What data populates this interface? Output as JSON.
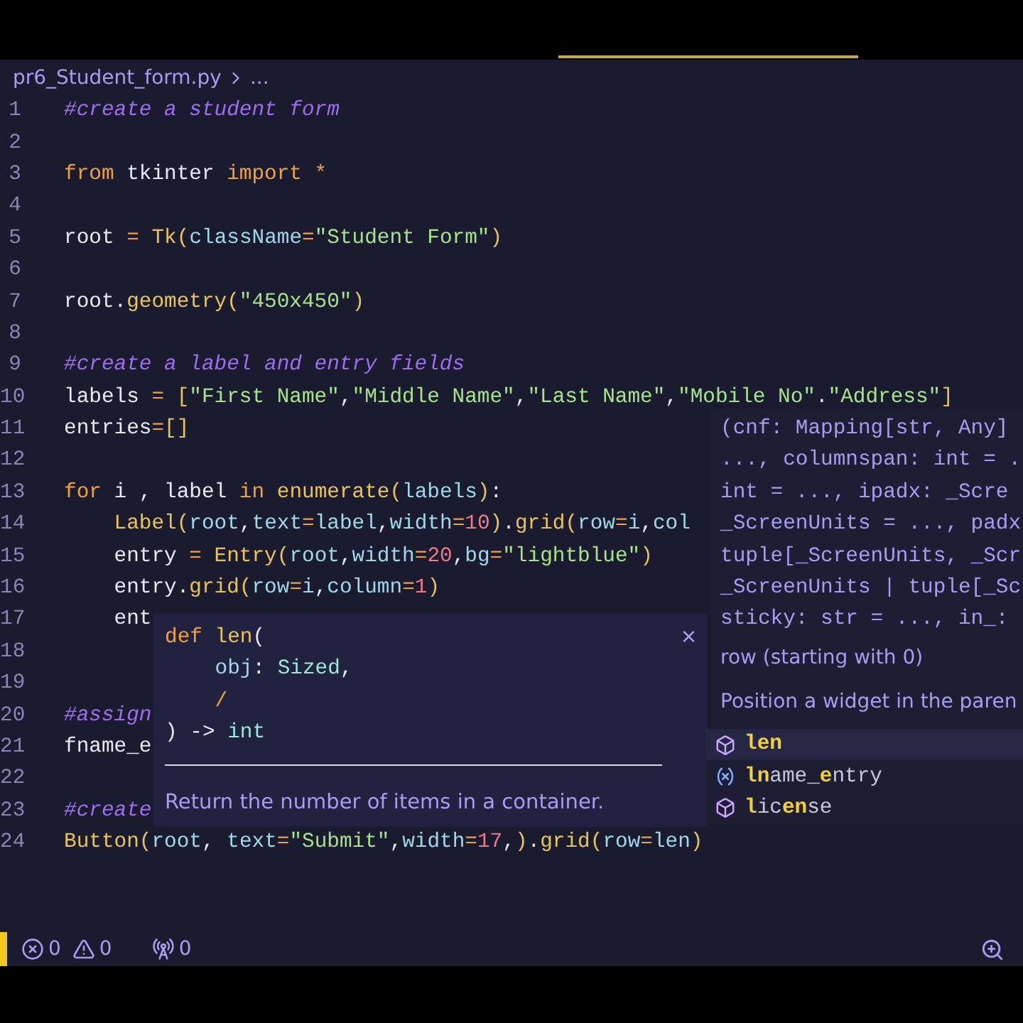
{
  "breadcrumb": {
    "file": "pr6_Student_form.py",
    "tail": "..."
  },
  "lines": [
    {
      "number": "1",
      "tokens": [
        {
          "text": "#create a student form",
          "kind": "comment"
        }
      ]
    },
    {
      "number": "2"
    },
    {
      "number": "3",
      "tokens": [
        {
          "text": "from",
          "kind": "keyword"
        },
        {
          "text": " tkinter ",
          "kind": "name"
        },
        {
          "text": "import",
          "kind": "keyword"
        },
        {
          "text": " *",
          "kind": "op"
        }
      ]
    },
    {
      "number": "4"
    },
    {
      "number": "5",
      "tokens": [
        {
          "text": "root ",
          "kind": "name"
        },
        {
          "text": "= ",
          "kind": "op"
        },
        {
          "text": "Tk",
          "kind": "func"
        },
        {
          "text": "(",
          "kind": "paren"
        },
        {
          "text": "className",
          "kind": "param"
        },
        {
          "text": "=",
          "kind": "op"
        },
        {
          "text": "\"Student Form\"",
          "kind": "string"
        },
        {
          "text": ")",
          "kind": "paren"
        }
      ]
    },
    {
      "number": "6"
    },
    {
      "number": "7",
      "tokens": [
        {
          "text": "root.",
          "kind": "name"
        },
        {
          "text": "geometry",
          "kind": "func"
        },
        {
          "text": "(",
          "kind": "paren"
        },
        {
          "text": "\"450x450\"",
          "kind": "string"
        },
        {
          "text": ")",
          "kind": "paren"
        }
      ]
    },
    {
      "number": "8"
    },
    {
      "number": "9",
      "tokens": [
        {
          "text": "#create a label and entry fields",
          "kind": "comment"
        }
      ]
    },
    {
      "number": "10",
      "tokens": [
        {
          "text": "labels ",
          "kind": "name"
        },
        {
          "text": "= ",
          "kind": "op"
        },
        {
          "text": "[",
          "kind": "paren"
        },
        {
          "text": "\"First Name\"",
          "kind": "string"
        },
        {
          "text": ",",
          "kind": "name"
        },
        {
          "text": "\"Middle Name\"",
          "kind": "string"
        },
        {
          "text": ",",
          "kind": "name"
        },
        {
          "text": "\"Last Name\"",
          "kind": "string"
        },
        {
          "text": ",",
          "kind": "name"
        },
        {
          "text": "\"Mobile No\"",
          "kind": "string"
        },
        {
          "text": ".",
          "kind": "name"
        },
        {
          "text": "\"Address\"",
          "kind": "string"
        },
        {
          "text": "]",
          "kind": "paren"
        }
      ]
    },
    {
      "number": "11",
      "tokens": [
        {
          "text": "entries",
          "kind": "name"
        },
        {
          "text": "=",
          "kind": "op"
        },
        {
          "text": "[]",
          "kind": "paren"
        }
      ]
    },
    {
      "number": "12"
    },
    {
      "number": "13",
      "tokens": [
        {
          "text": "for",
          "kind": "keyword"
        },
        {
          "text": " i , label ",
          "kind": "name"
        },
        {
          "text": "in ",
          "kind": "keyword"
        },
        {
          "text": "enumerate",
          "kind": "func"
        },
        {
          "text": "(",
          "kind": "paren"
        },
        {
          "text": "labels",
          "kind": "param"
        },
        {
          "text": ")",
          "kind": "paren"
        },
        {
          "text": ":",
          "kind": "name"
        }
      ]
    },
    {
      "number": "14",
      "tokens": [
        {
          "text": "    Label",
          "kind": "func"
        },
        {
          "text": "(",
          "kind": "paren"
        },
        {
          "text": "root",
          "kind": "param"
        },
        {
          "text": ",",
          "kind": "name"
        },
        {
          "text": "text",
          "kind": "param"
        },
        {
          "text": "=",
          "kind": "op"
        },
        {
          "text": "label",
          "kind": "param"
        },
        {
          "text": ",",
          "kind": "name"
        },
        {
          "text": "width",
          "kind": "param"
        },
        {
          "text": "=",
          "kind": "op"
        },
        {
          "text": "10",
          "kind": "number"
        },
        {
          "text": ")",
          "kind": "paren"
        },
        {
          "text": ".",
          "kind": "name"
        },
        {
          "text": "grid",
          "kind": "func"
        },
        {
          "text": "(",
          "kind": "paren"
        },
        {
          "text": "row",
          "kind": "param"
        },
        {
          "text": "=",
          "kind": "op"
        },
        {
          "text": "i",
          "kind": "param"
        },
        {
          "text": ",",
          "kind": "name"
        },
        {
          "text": "col",
          "kind": "param"
        }
      ]
    },
    {
      "number": "15",
      "tokens": [
        {
          "text": "    entry ",
          "kind": "name"
        },
        {
          "text": "= ",
          "kind": "op"
        },
        {
          "text": "Entry",
          "kind": "func"
        },
        {
          "text": "(",
          "kind": "paren"
        },
        {
          "text": "root",
          "kind": "param"
        },
        {
          "text": ",",
          "kind": "name"
        },
        {
          "text": "width",
          "kind": "param"
        },
        {
          "text": "=",
          "kind": "op"
        },
        {
          "text": "20",
          "kind": "number"
        },
        {
          "text": ",",
          "kind": "name"
        },
        {
          "text": "bg",
          "kind": "param"
        },
        {
          "text": "=",
          "kind": "op"
        },
        {
          "text": "\"lightblue\"",
          "kind": "string"
        },
        {
          "text": ")",
          "kind": "paren"
        }
      ]
    },
    {
      "number": "16",
      "tokens": [
        {
          "text": "    entry.",
          "kind": "name"
        },
        {
          "text": "grid",
          "kind": "func"
        },
        {
          "text": "(",
          "kind": "paren"
        },
        {
          "text": "row",
          "kind": "param"
        },
        {
          "text": "=",
          "kind": "op"
        },
        {
          "text": "i",
          "kind": "param"
        },
        {
          "text": ",",
          "kind": "name"
        },
        {
          "text": "column",
          "kind": "param"
        },
        {
          "text": "=",
          "kind": "op"
        },
        {
          "text": "1",
          "kind": "number"
        },
        {
          "text": ")",
          "kind": "paren"
        }
      ]
    },
    {
      "number": "17",
      "tokens": [
        {
          "text": "    ent",
          "kind": "name"
        }
      ]
    },
    {
      "number": "18"
    },
    {
      "number": "19"
    },
    {
      "number": "20",
      "tokens": [
        {
          "text": "#assign",
          "kind": "comment"
        }
      ]
    },
    {
      "number": "21",
      "tokens": [
        {
          "text": "fname_e",
          "kind": "name"
        }
      ]
    },
    {
      "number": "22"
    },
    {
      "number": "23",
      "tokens": [
        {
          "text": "#create",
          "kind": "comment"
        }
      ]
    },
    {
      "number": "24",
      "tokens": [
        {
          "text": "Button",
          "kind": "func"
        },
        {
          "text": "(",
          "kind": "paren"
        },
        {
          "text": "root",
          "kind": "param"
        },
        {
          "text": ", ",
          "kind": "name"
        },
        {
          "text": "text",
          "kind": "param"
        },
        {
          "text": "=",
          "kind": "op"
        },
        {
          "text": "\"Submit\"",
          "kind": "string"
        },
        {
          "text": ",",
          "kind": "name"
        },
        {
          "text": "width",
          "kind": "param"
        },
        {
          "text": "=",
          "kind": "op"
        },
        {
          "text": "17",
          "kind": "number"
        },
        {
          "text": ",",
          "kind": "name"
        },
        {
          "text": ")",
          "kind": "paren"
        },
        {
          "text": ".",
          "kind": "name"
        },
        {
          "text": "grid",
          "kind": "func"
        },
        {
          "text": "(",
          "kind": "paren"
        },
        {
          "text": "row",
          "kind": "param"
        },
        {
          "text": "=",
          "kind": "op"
        },
        {
          "text": "len",
          "kind": "param"
        },
        {
          "text": ")",
          "kind": "paren"
        }
      ]
    }
  ],
  "signature_help": {
    "lines": [
      "(cnf: Mapping[str, Any]",
      "..., columnspan: int = .",
      "int = ..., ipadx: _Scre",
      "_ScreenUnits = ..., padx",
      "tuple[_ScreenUnits, _Scr",
      "_ScreenUnits | tuple[_Sc",
      "sticky: str = ..., in_:"
    ],
    "param_doc": "row (starting with 0)",
    "description": "Position a widget in the paren"
  },
  "hover": {
    "close": "×",
    "code": [
      [
        {
          "text": "def ",
          "kind": "keyword"
        },
        {
          "text": "len",
          "kind": "func"
        },
        {
          "text": "(",
          "kind": "name"
        }
      ],
      [
        {
          "text": "    obj",
          "kind": "param"
        },
        {
          "text": ": ",
          "kind": "name"
        },
        {
          "text": "Sized",
          "kind": "type"
        },
        {
          "text": ",",
          "kind": "name"
        }
      ],
      [
        {
          "text": "    /",
          "kind": "op"
        }
      ],
      [
        {
          "text": ")",
          "kind": "name"
        },
        {
          "text": " -> ",
          "kind": "name"
        },
        {
          "text": "int",
          "kind": "type"
        }
      ]
    ],
    "doc": "Return the number of items in a container."
  },
  "suggestions": [
    {
      "label": "**len**",
      "kind": "module",
      "selected": true
    },
    {
      "label": "**ln**ame_**e**ntry",
      "kind": "variable",
      "selected": false
    },
    {
      "label": "**l**ic**en**se",
      "kind": "module",
      "selected": false
    }
  ],
  "status_bar": [
    {
      "kind": "errors",
      "count": "0"
    },
    {
      "kind": "warnings",
      "count": "0"
    },
    {
      "kind": "ports",
      "count": "0"
    }
  ]
}
